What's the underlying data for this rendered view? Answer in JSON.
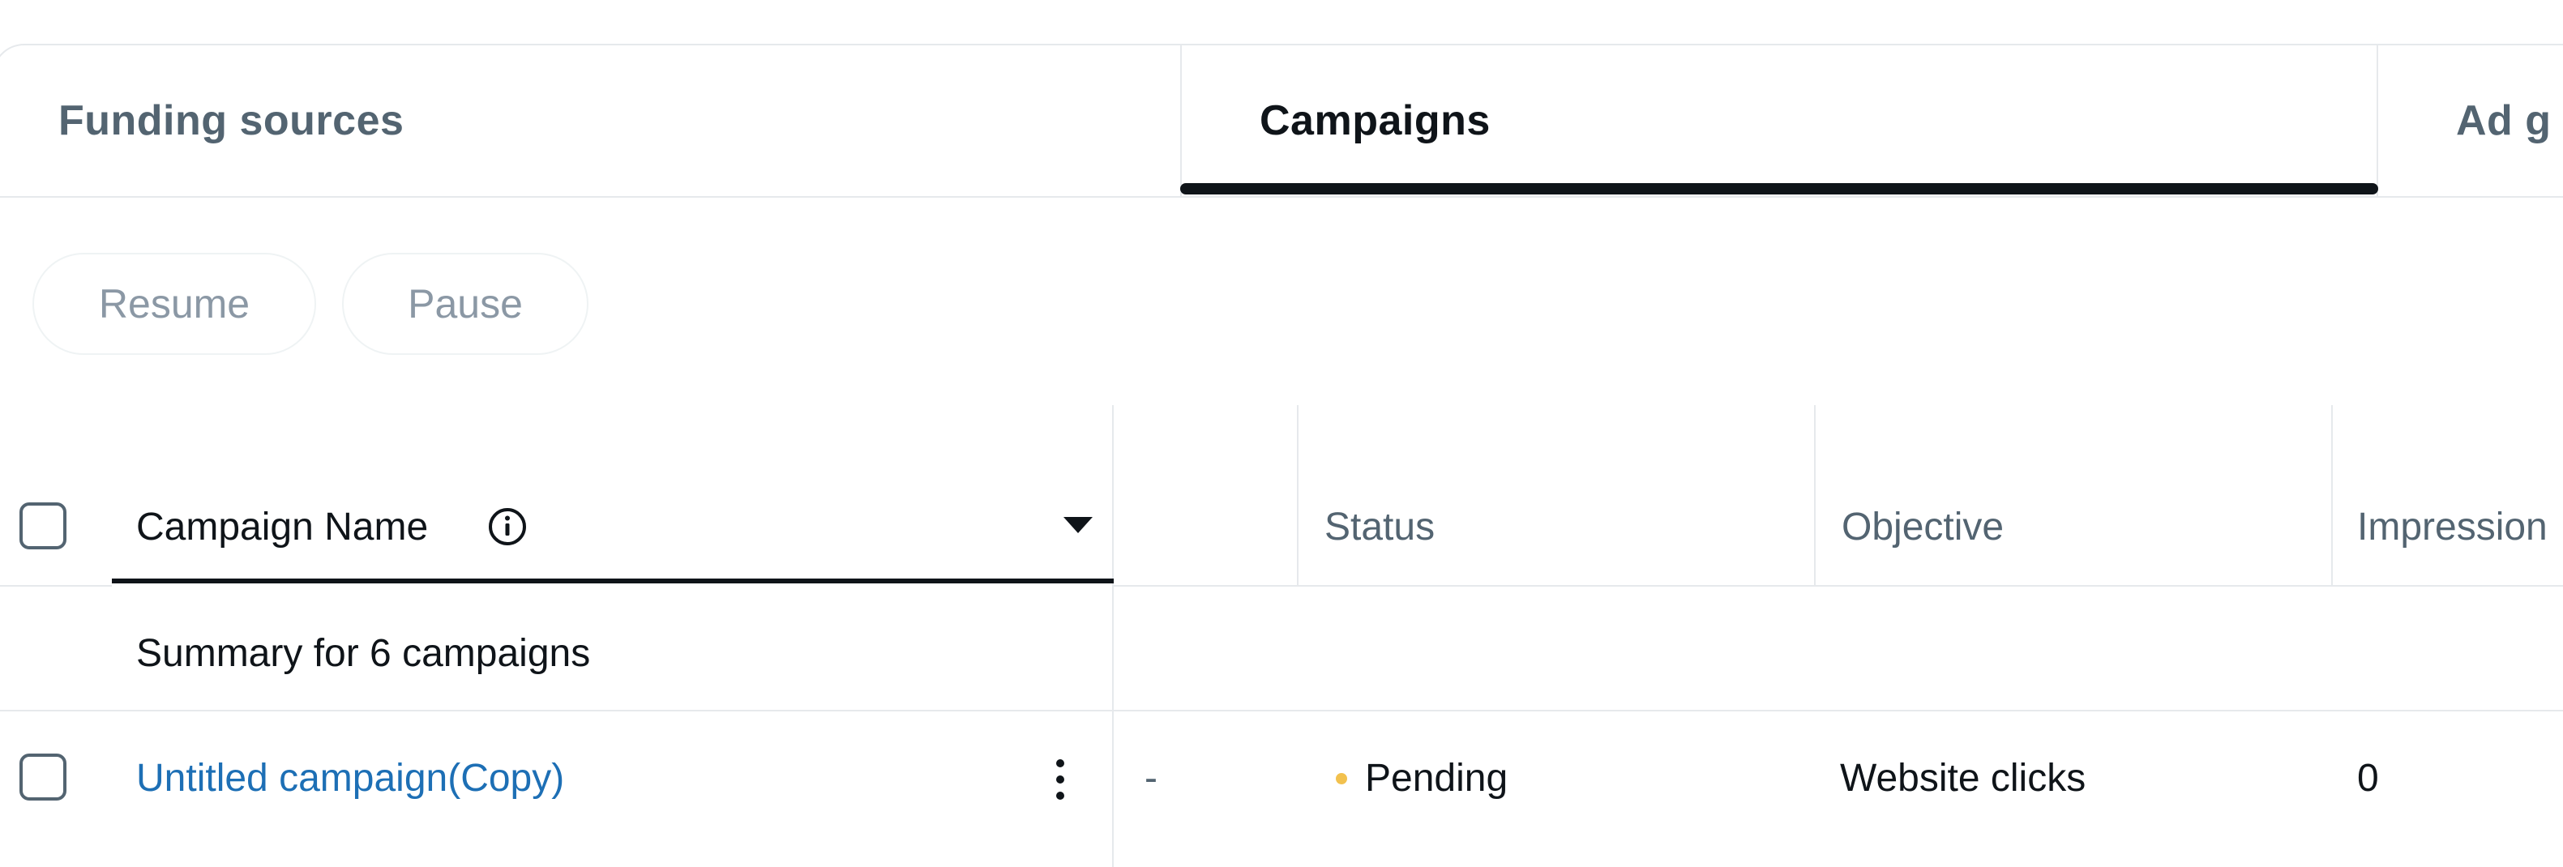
{
  "tabs": [
    {
      "label": "Funding sources",
      "active": false
    },
    {
      "label": "Campaigns",
      "active": true
    },
    {
      "label": "Ad g",
      "active": false
    }
  ],
  "actions": {
    "resume_label": "Resume",
    "pause_label": "Pause"
  },
  "table": {
    "columns": [
      {
        "label": "Campaign Name",
        "sortable": true,
        "info": true
      },
      {
        "label": "",
        "sortable": false
      },
      {
        "label": "Status"
      },
      {
        "label": "Objective"
      },
      {
        "label": "Impression"
      }
    ],
    "summary": "Summary for 6 campaigns",
    "rows": [
      {
        "name": "Untitled campaign(Copy)",
        "extra": "-",
        "status": "Pending",
        "status_color": "#f2c14e",
        "objective": "Website clicks",
        "impressions": "0"
      }
    ]
  },
  "icons": {
    "info": "info-circle-icon",
    "sort": "caret-down-icon",
    "row_menu": "vertical-ellipsis-icon"
  },
  "colors": {
    "link": "#1d6fb5",
    "text_primary": "#0f1419",
    "text_secondary": "#536471",
    "border": "#e6e9ec",
    "active_underline": "#0f1419"
  }
}
